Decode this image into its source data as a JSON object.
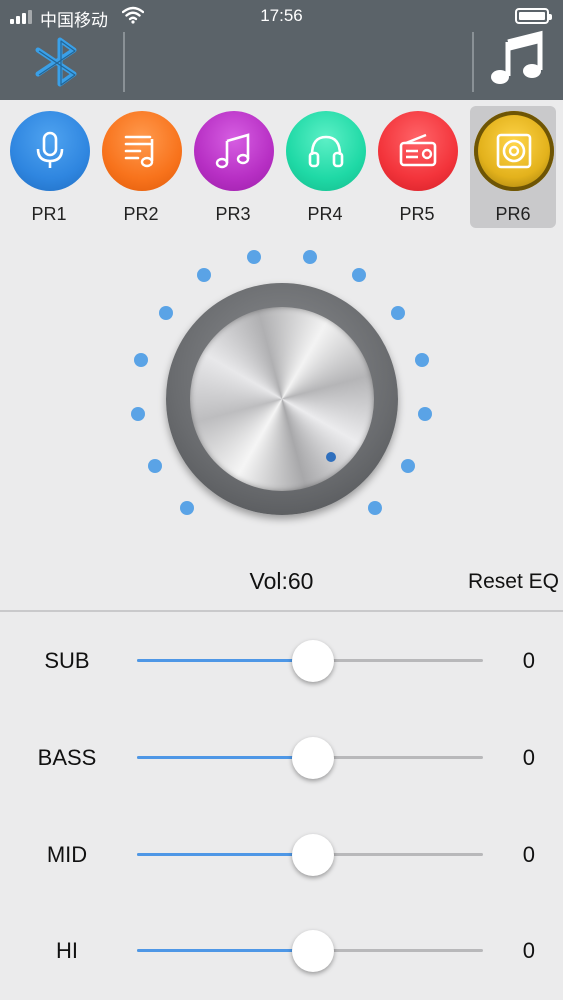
{
  "status_bar": {
    "carrier": "中国移动",
    "time": "17:56",
    "signal_bars": 3,
    "battery_level": 1.0
  },
  "header": {
    "left_icon": "bluetooth-icon",
    "right_icon": "music-note-icon"
  },
  "presets": [
    {
      "label": "PR1",
      "icon": "microphone-icon",
      "color": "#2f86e0",
      "selected": false
    },
    {
      "label": "PR2",
      "icon": "music-list-icon",
      "color": "#f8731c",
      "selected": false
    },
    {
      "label": "PR3",
      "icon": "music-note-icon",
      "color": "#b72fc4",
      "selected": false
    },
    {
      "label": "PR4",
      "icon": "headphones-icon",
      "color": "#1fd9a6",
      "selected": false
    },
    {
      "label": "PR5",
      "icon": "radio-icon",
      "color": "#f3343b",
      "selected": false
    },
    {
      "label": "PR6",
      "icon": "speaker-icon",
      "color": "#e3b21c",
      "selected": true
    }
  ],
  "volume": {
    "label": "Vol:60",
    "value": 60
  },
  "reset_label": "Reset EQ",
  "eq": [
    {
      "name": "SUB",
      "value": "0",
      "position": 0.5
    },
    {
      "name": "BASS",
      "value": "0",
      "position": 0.5
    },
    {
      "name": "MID",
      "value": "0",
      "position": 0.5
    },
    {
      "name": "HI",
      "value": "0",
      "position": 0.5
    }
  ],
  "colors": {
    "header_bg": "#5b6369",
    "accent": "#4e97e6",
    "knob_dot": "#5aa3e6"
  }
}
